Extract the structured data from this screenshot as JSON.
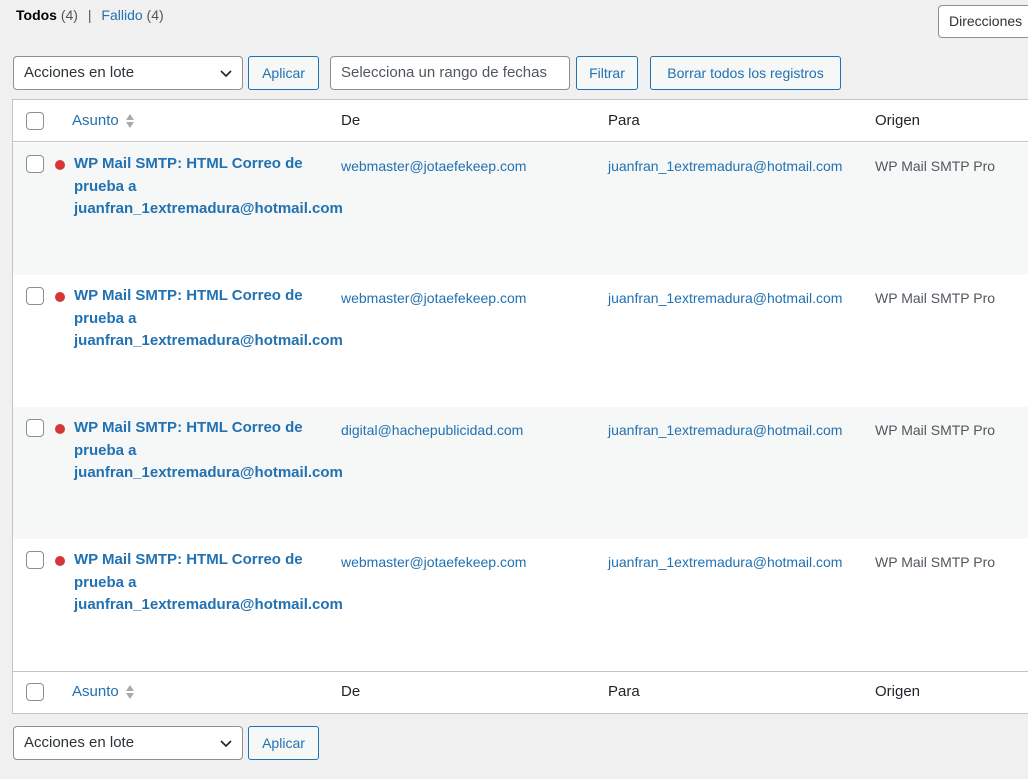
{
  "views": {
    "all_label": "Todos",
    "all_count": "(4)",
    "separator": "|",
    "failed_label": "Fallido",
    "failed_count": "(4)"
  },
  "address_filter": {
    "selected": "Direcciones"
  },
  "top_actions": {
    "bulk_select": "Acciones en lote",
    "apply_label": "Aplicar",
    "date_range_placeholder": "Selecciona un rango de fechas",
    "filter_label": "Filtrar",
    "delete_all_label": "Borrar todos los registros"
  },
  "table": {
    "columns": {
      "subject": "Asunto",
      "from": "De",
      "to": "Para",
      "origin": "Origen"
    },
    "rows": [
      {
        "status": "failed",
        "subject": "WP Mail SMTP: HTML Correo de prueba a juanfran_1extremadura@hotmail.com",
        "from": "webmaster@jotaefekeep.com",
        "to": "juanfran_1extremadura@hotmail.com",
        "origin": "WP Mail SMTP Pro"
      },
      {
        "status": "failed",
        "subject": "WP Mail SMTP: HTML Correo de prueba a juanfran_1extremadura@hotmail.com",
        "from": "webmaster@jotaefekeep.com",
        "to": "juanfran_1extremadura@hotmail.com",
        "origin": "WP Mail SMTP Pro"
      },
      {
        "status": "failed",
        "subject": "WP Mail SMTP: HTML Correo de prueba a juanfran_1extremadura@hotmail.com",
        "from": "digital@hachepublicidad.com",
        "to": "juanfran_1extremadura@hotmail.com",
        "origin": "WP Mail SMTP Pro"
      },
      {
        "status": "failed",
        "subject": "WP Mail SMTP: HTML Correo de prueba a juanfran_1extremadura@hotmail.com",
        "from": "webmaster@jotaefekeep.com",
        "to": "juanfran_1extremadura@hotmail.com",
        "origin": "WP Mail SMTP Pro"
      }
    ]
  },
  "bottom_actions": {
    "bulk_select": "Acciones en lote",
    "apply_label": "Aplicar"
  },
  "colors": {
    "link": "#2271b1",
    "failed_status": "#d63638"
  }
}
